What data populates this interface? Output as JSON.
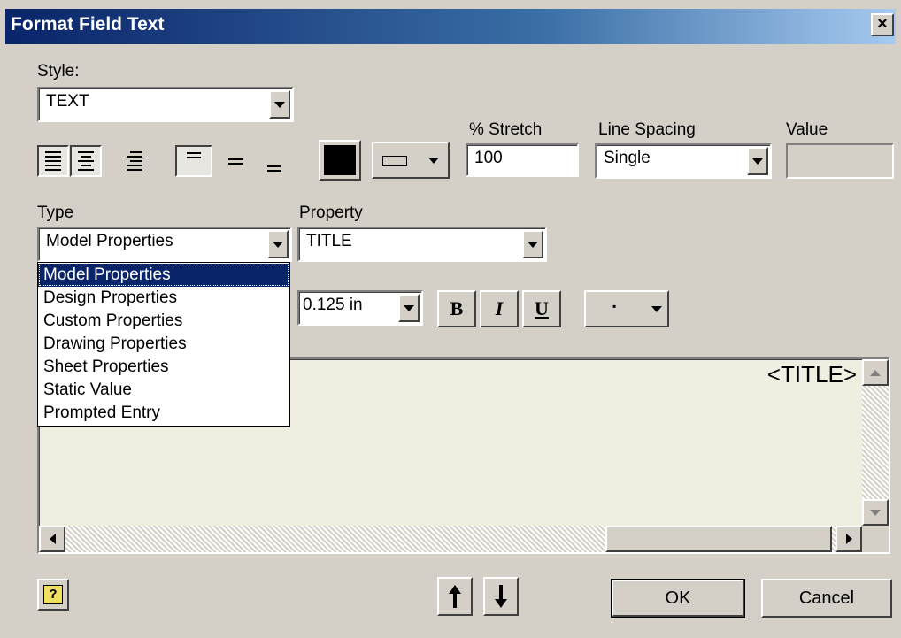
{
  "window": {
    "title": "Format Field Text",
    "close_glyph": "×"
  },
  "style": {
    "label": "Style:",
    "value": "TEXT"
  },
  "stretch": {
    "label": "% Stretch",
    "value": "100"
  },
  "line_spacing": {
    "label": "Line Spacing",
    "value": "Single"
  },
  "value_field": {
    "label": "Value",
    "value": ""
  },
  "type": {
    "label": "Type",
    "value": "Model Properties",
    "options": [
      "Model Properties",
      "Design Properties",
      "Custom Properties",
      "Drawing Properties",
      "Sheet Properties",
      "Static Value",
      "Prompted Entry"
    ],
    "selected_index": 0
  },
  "property": {
    "label": "Property",
    "value": "TITLE"
  },
  "font_size": {
    "value": "0.125 in"
  },
  "format": {
    "bold": "B",
    "italic": "I",
    "underline": "U",
    "symbol": "▪"
  },
  "editor": {
    "content": "<TITLE>"
  },
  "buttons": {
    "ok": "OK",
    "cancel": "Cancel",
    "help": "?"
  },
  "colors": {
    "text_color": "#000000",
    "title_bar": "#0a246a",
    "editor_bg": "#efeee0"
  }
}
